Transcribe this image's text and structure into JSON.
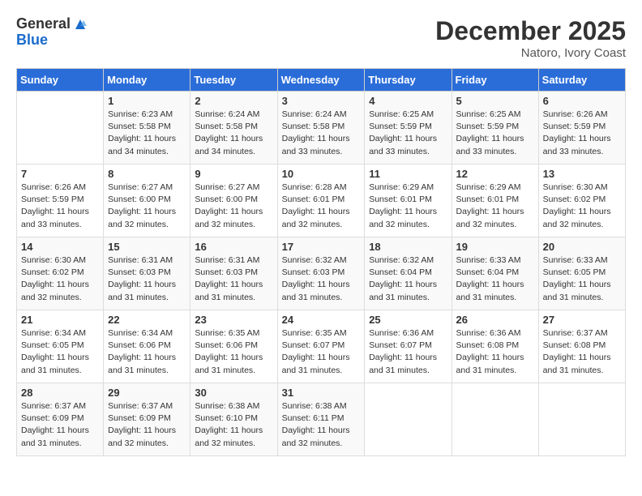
{
  "logo": {
    "general": "General",
    "blue": "Blue"
  },
  "title": "December 2025",
  "location": "Natoro, Ivory Coast",
  "days_of_week": [
    "Sunday",
    "Monday",
    "Tuesday",
    "Wednesday",
    "Thursday",
    "Friday",
    "Saturday"
  ],
  "weeks": [
    [
      {
        "day": "",
        "sunrise": "",
        "sunset": "",
        "daylight": ""
      },
      {
        "day": "1",
        "sunrise": "Sunrise: 6:23 AM",
        "sunset": "Sunset: 5:58 PM",
        "daylight": "Daylight: 11 hours and 34 minutes."
      },
      {
        "day": "2",
        "sunrise": "Sunrise: 6:24 AM",
        "sunset": "Sunset: 5:58 PM",
        "daylight": "Daylight: 11 hours and 34 minutes."
      },
      {
        "day": "3",
        "sunrise": "Sunrise: 6:24 AM",
        "sunset": "Sunset: 5:58 PM",
        "daylight": "Daylight: 11 hours and 33 minutes."
      },
      {
        "day": "4",
        "sunrise": "Sunrise: 6:25 AM",
        "sunset": "Sunset: 5:59 PM",
        "daylight": "Daylight: 11 hours and 33 minutes."
      },
      {
        "day": "5",
        "sunrise": "Sunrise: 6:25 AM",
        "sunset": "Sunset: 5:59 PM",
        "daylight": "Daylight: 11 hours and 33 minutes."
      },
      {
        "day": "6",
        "sunrise": "Sunrise: 6:26 AM",
        "sunset": "Sunset: 5:59 PM",
        "daylight": "Daylight: 11 hours and 33 minutes."
      }
    ],
    [
      {
        "day": "7",
        "sunrise": "Sunrise: 6:26 AM",
        "sunset": "Sunset: 5:59 PM",
        "daylight": "Daylight: 11 hours and 33 minutes."
      },
      {
        "day": "8",
        "sunrise": "Sunrise: 6:27 AM",
        "sunset": "Sunset: 6:00 PM",
        "daylight": "Daylight: 11 hours and 32 minutes."
      },
      {
        "day": "9",
        "sunrise": "Sunrise: 6:27 AM",
        "sunset": "Sunset: 6:00 PM",
        "daylight": "Daylight: 11 hours and 32 minutes."
      },
      {
        "day": "10",
        "sunrise": "Sunrise: 6:28 AM",
        "sunset": "Sunset: 6:01 PM",
        "daylight": "Daylight: 11 hours and 32 minutes."
      },
      {
        "day": "11",
        "sunrise": "Sunrise: 6:29 AM",
        "sunset": "Sunset: 6:01 PM",
        "daylight": "Daylight: 11 hours and 32 minutes."
      },
      {
        "day": "12",
        "sunrise": "Sunrise: 6:29 AM",
        "sunset": "Sunset: 6:01 PM",
        "daylight": "Daylight: 11 hours and 32 minutes."
      },
      {
        "day": "13",
        "sunrise": "Sunrise: 6:30 AM",
        "sunset": "Sunset: 6:02 PM",
        "daylight": "Daylight: 11 hours and 32 minutes."
      }
    ],
    [
      {
        "day": "14",
        "sunrise": "Sunrise: 6:30 AM",
        "sunset": "Sunset: 6:02 PM",
        "daylight": "Daylight: 11 hours and 32 minutes."
      },
      {
        "day": "15",
        "sunrise": "Sunrise: 6:31 AM",
        "sunset": "Sunset: 6:03 PM",
        "daylight": "Daylight: 11 hours and 31 minutes."
      },
      {
        "day": "16",
        "sunrise": "Sunrise: 6:31 AM",
        "sunset": "Sunset: 6:03 PM",
        "daylight": "Daylight: 11 hours and 31 minutes."
      },
      {
        "day": "17",
        "sunrise": "Sunrise: 6:32 AM",
        "sunset": "Sunset: 6:03 PM",
        "daylight": "Daylight: 11 hours and 31 minutes."
      },
      {
        "day": "18",
        "sunrise": "Sunrise: 6:32 AM",
        "sunset": "Sunset: 6:04 PM",
        "daylight": "Daylight: 11 hours and 31 minutes."
      },
      {
        "day": "19",
        "sunrise": "Sunrise: 6:33 AM",
        "sunset": "Sunset: 6:04 PM",
        "daylight": "Daylight: 11 hours and 31 minutes."
      },
      {
        "day": "20",
        "sunrise": "Sunrise: 6:33 AM",
        "sunset": "Sunset: 6:05 PM",
        "daylight": "Daylight: 11 hours and 31 minutes."
      }
    ],
    [
      {
        "day": "21",
        "sunrise": "Sunrise: 6:34 AM",
        "sunset": "Sunset: 6:05 PM",
        "daylight": "Daylight: 11 hours and 31 minutes."
      },
      {
        "day": "22",
        "sunrise": "Sunrise: 6:34 AM",
        "sunset": "Sunset: 6:06 PM",
        "daylight": "Daylight: 11 hours and 31 minutes."
      },
      {
        "day": "23",
        "sunrise": "Sunrise: 6:35 AM",
        "sunset": "Sunset: 6:06 PM",
        "daylight": "Daylight: 11 hours and 31 minutes."
      },
      {
        "day": "24",
        "sunrise": "Sunrise: 6:35 AM",
        "sunset": "Sunset: 6:07 PM",
        "daylight": "Daylight: 11 hours and 31 minutes."
      },
      {
        "day": "25",
        "sunrise": "Sunrise: 6:36 AM",
        "sunset": "Sunset: 6:07 PM",
        "daylight": "Daylight: 11 hours and 31 minutes."
      },
      {
        "day": "26",
        "sunrise": "Sunrise: 6:36 AM",
        "sunset": "Sunset: 6:08 PM",
        "daylight": "Daylight: 11 hours and 31 minutes."
      },
      {
        "day": "27",
        "sunrise": "Sunrise: 6:37 AM",
        "sunset": "Sunset: 6:08 PM",
        "daylight": "Daylight: 11 hours and 31 minutes."
      }
    ],
    [
      {
        "day": "28",
        "sunrise": "Sunrise: 6:37 AM",
        "sunset": "Sunset: 6:09 PM",
        "daylight": "Daylight: 11 hours and 31 minutes."
      },
      {
        "day": "29",
        "sunrise": "Sunrise: 6:37 AM",
        "sunset": "Sunset: 6:09 PM",
        "daylight": "Daylight: 11 hours and 32 minutes."
      },
      {
        "day": "30",
        "sunrise": "Sunrise: 6:38 AM",
        "sunset": "Sunset: 6:10 PM",
        "daylight": "Daylight: 11 hours and 32 minutes."
      },
      {
        "day": "31",
        "sunrise": "Sunrise: 6:38 AM",
        "sunset": "Sunset: 6:11 PM",
        "daylight": "Daylight: 11 hours and 32 minutes."
      },
      {
        "day": "",
        "sunrise": "",
        "sunset": "",
        "daylight": ""
      },
      {
        "day": "",
        "sunrise": "",
        "sunset": "",
        "daylight": ""
      },
      {
        "day": "",
        "sunrise": "",
        "sunset": "",
        "daylight": ""
      }
    ]
  ]
}
